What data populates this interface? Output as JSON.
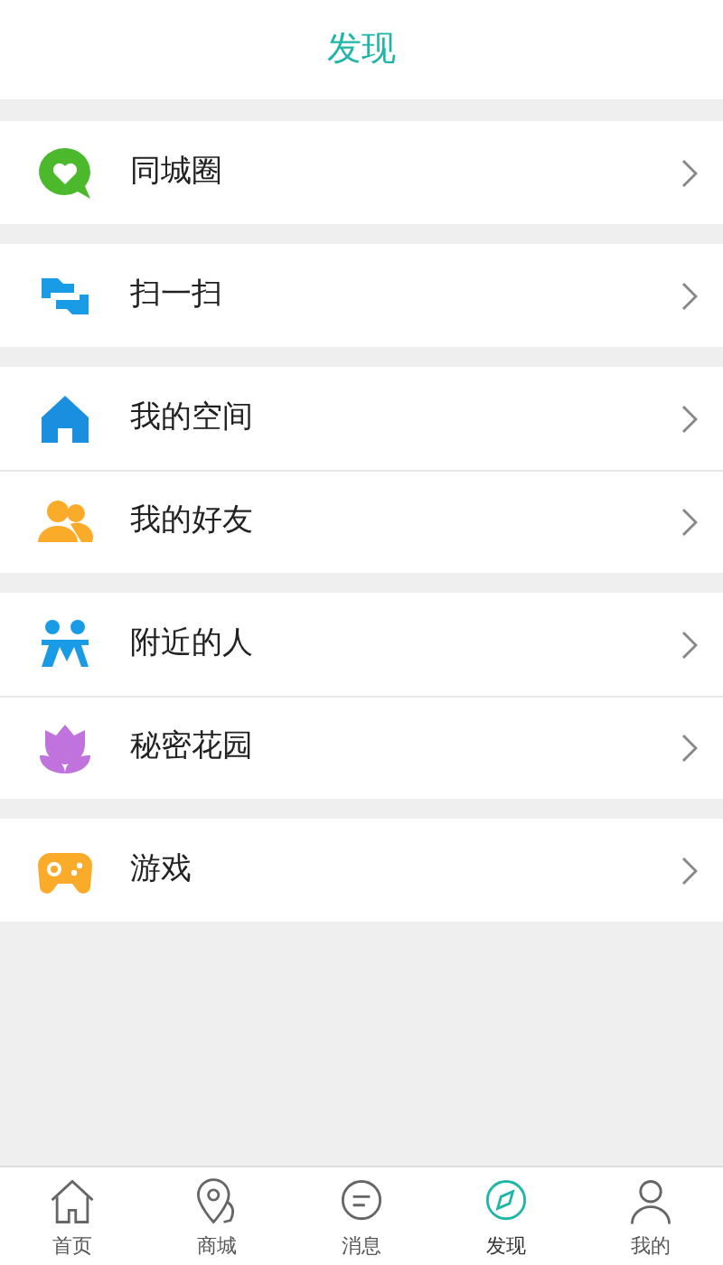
{
  "header": {
    "title": "发现"
  },
  "groups": [
    {
      "items": [
        {
          "label": "同城圈"
        }
      ]
    },
    {
      "items": [
        {
          "label": "扫一扫"
        }
      ]
    },
    {
      "items": [
        {
          "label": "我的空间"
        },
        {
          "label": "我的好友"
        }
      ]
    },
    {
      "items": [
        {
          "label": "附近的人"
        },
        {
          "label": "秘密花园"
        }
      ]
    },
    {
      "items": [
        {
          "label": "游戏"
        }
      ]
    }
  ],
  "tabs": [
    {
      "label": "首页",
      "selected": false
    },
    {
      "label": "商城",
      "selected": false
    },
    {
      "label": "消息",
      "selected": false
    },
    {
      "label": "发现",
      "selected": true
    },
    {
      "label": "我的",
      "selected": false
    }
  ]
}
